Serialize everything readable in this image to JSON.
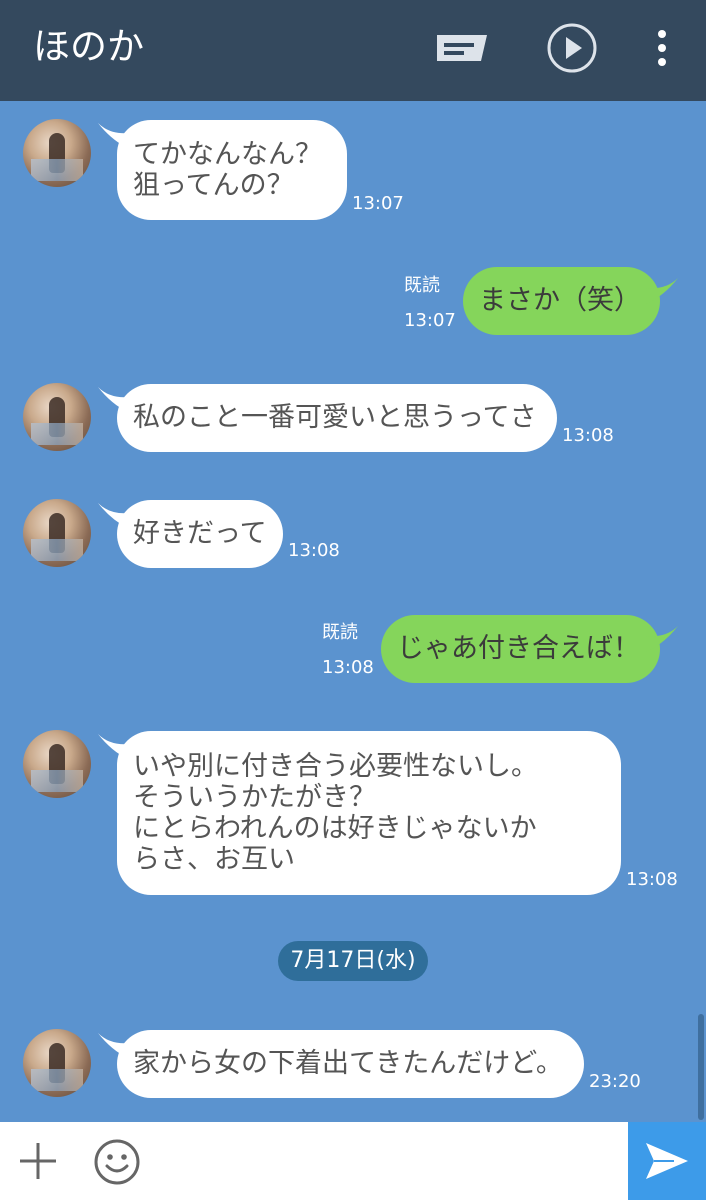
{
  "header": {
    "title": "ほのか",
    "icons": [
      "chat-memo-icon",
      "play-icon",
      "more-vert-icon"
    ]
  },
  "messages": [
    {
      "side": "in",
      "lines": [
        "てかなんなん？",
        "狙ってんの？"
      ],
      "time": "13:07"
    },
    {
      "side": "out",
      "lines": [
        "まさか（笑）"
      ],
      "time": "13:07",
      "read": "既読"
    },
    {
      "side": "in",
      "lines": [
        "私のこと一番可愛いと思うってさ"
      ],
      "time": "13:08"
    },
    {
      "side": "in",
      "lines": [
        "好きだって"
      ],
      "time": "13:08"
    },
    {
      "side": "out",
      "lines": [
        "じゃあ付き合えば！"
      ],
      "time": "13:08",
      "read": "既読"
    },
    {
      "side": "in",
      "lines": [
        "いや別に付き合う必要性ないし。",
        "そういうかたがき？",
        "にとらわれんのは好きじゃないか",
        "らさ、お互い"
      ],
      "time": "13:08"
    },
    {
      "side": "in",
      "lines": [
        "家から女の下着出てきたんだけど。"
      ],
      "time": "23:20"
    }
  ],
  "date_separator": "7月17日(水)",
  "input": {
    "value": "",
    "placeholder": ""
  },
  "colors": {
    "background": "#5b93cf",
    "header": "#34495e",
    "incoming_bubble": "#ffffff",
    "outgoing_bubble": "#85d55b",
    "send_button": "#3d9be9"
  }
}
